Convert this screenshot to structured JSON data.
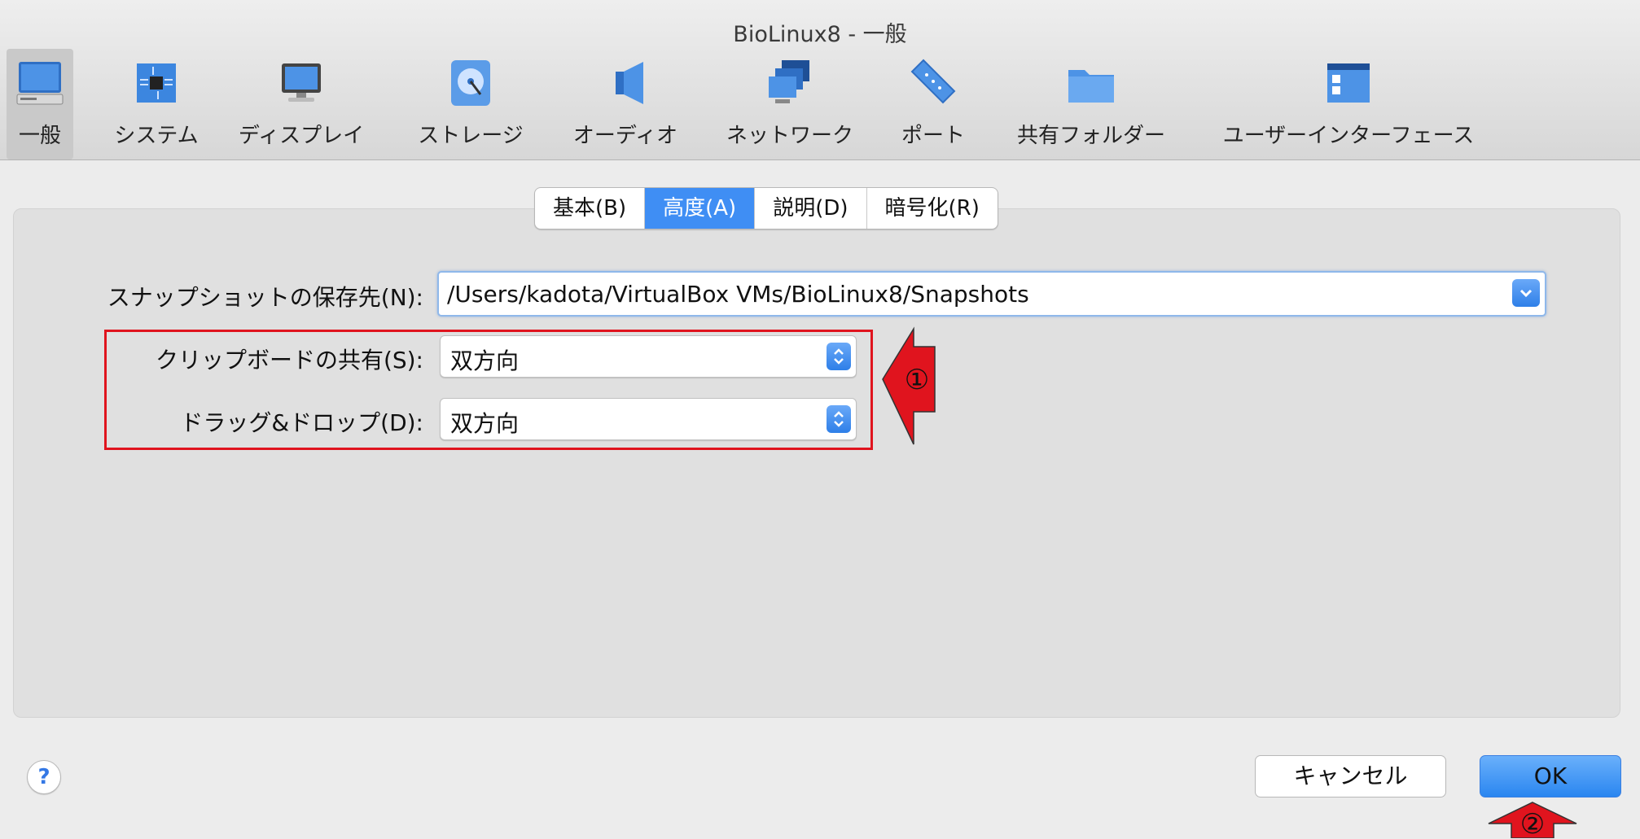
{
  "window": {
    "title": "BioLinux8 - 一般"
  },
  "toolbar": {
    "items": [
      {
        "label": "一般",
        "icon": "monitor-general-icon"
      },
      {
        "label": "システム",
        "icon": "chip-icon"
      },
      {
        "label": "ディスプレイ",
        "icon": "display-icon"
      },
      {
        "label": "ストレージ",
        "icon": "disk-icon"
      },
      {
        "label": "オーディオ",
        "icon": "speaker-icon"
      },
      {
        "label": "ネットワーク",
        "icon": "network-icon"
      },
      {
        "label": "ポート",
        "icon": "serial-port-icon"
      },
      {
        "label": "共有フォルダー",
        "icon": "folder-icon"
      },
      {
        "label": "ユーザーインターフェース",
        "icon": "ui-window-icon"
      }
    ],
    "selected": "一般"
  },
  "tabs": [
    {
      "label": "基本(B)"
    },
    {
      "label": "高度(A)"
    },
    {
      "label": "説明(D)"
    },
    {
      "label": "暗号化(R)"
    }
  ],
  "active_tab": "高度(A)",
  "form": {
    "snapshot_label": "スナップショットの保存先(N):",
    "snapshot_path": "/Users/kadota/VirtualBox VMs/BioLinux8/Snapshots",
    "clipboard_label": "クリップボードの共有(S):",
    "clipboard_value": "双方向",
    "dragdrop_label": "ドラッグ&ドロップ(D):",
    "dragdrop_value": "双方向"
  },
  "buttons": {
    "help": "?",
    "cancel": "キャンセル",
    "ok": "OK"
  },
  "annotations": {
    "marker1": "①",
    "marker2": "②",
    "color": "#e0141e"
  },
  "colors": {
    "accent": "#3f8ef4",
    "annotation_red": "#e0141e"
  }
}
